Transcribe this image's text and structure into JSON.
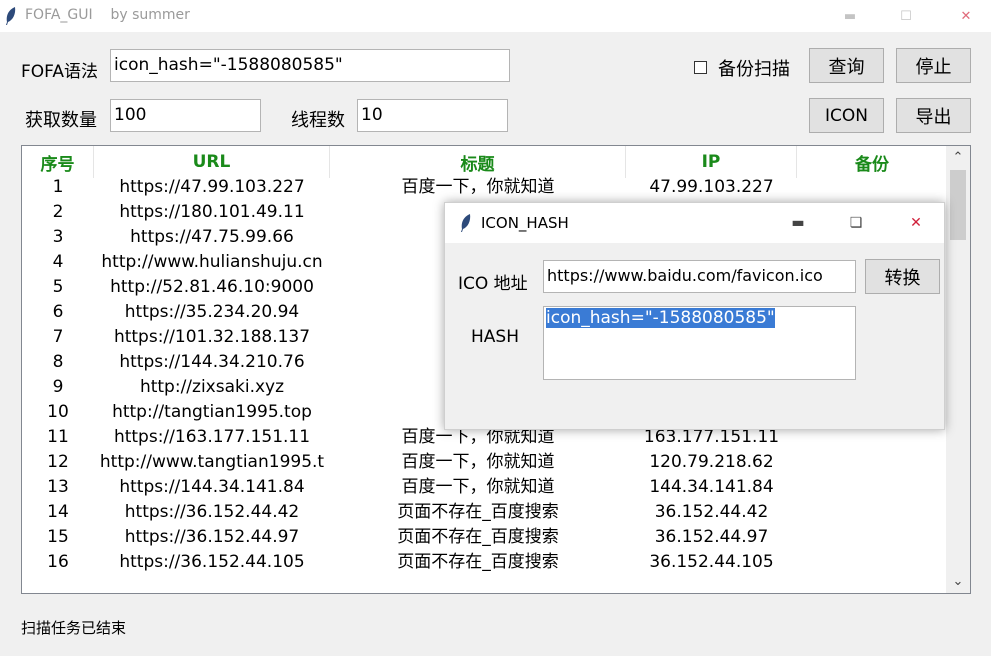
{
  "window": {
    "title": "FOFA_GUI    by summer",
    "minimize_icon": "minimize-icon",
    "maximize_icon": "maximize-icon",
    "close_icon": "close-icon"
  },
  "query": {
    "syntax_label": "FOFA语法",
    "syntax_value": "icon_hash=\"-1588080585\"",
    "backup_label": "备份扫描",
    "backup_checked": false,
    "search_button": "查询",
    "stop_button": "停止",
    "count_label": "获取数量",
    "count_value": "100",
    "threads_label": "线程数",
    "threads_value": "10",
    "icon_button": "ICON",
    "export_button": "导出"
  },
  "table": {
    "columns": [
      "序号",
      "URL",
      "标题",
      "IP",
      "备份"
    ],
    "rows": [
      [
        "1",
        "https://47.99.103.227",
        "百度一下，你就知道",
        "47.99.103.227",
        ""
      ],
      [
        "2",
        "https://180.101.49.11",
        "页面不",
        "",
        ""
      ],
      [
        "3",
        "https://47.75.99.66",
        "百度一",
        "",
        ""
      ],
      [
        "4",
        "http://www.hulianshuju.cn",
        "百度一",
        "",
        ""
      ],
      [
        "5",
        "http://52.81.46.10:9000",
        "百度一",
        "",
        ""
      ],
      [
        "6",
        "https://35.234.20.94",
        "百度一",
        "",
        ""
      ],
      [
        "7",
        "https://101.32.188.137",
        "百度一",
        "",
        ""
      ],
      [
        "8",
        "https://144.34.210.76",
        "百度一",
        "",
        ""
      ],
      [
        "9",
        "http://zixsaki.xyz",
        "百度一",
        "",
        ""
      ],
      [
        "10",
        "http://tangtian1995.top",
        "百度一",
        "",
        ""
      ],
      [
        "11",
        "https://163.177.151.11",
        "百度一下，你就知道",
        "163.177.151.11",
        ""
      ],
      [
        "12",
        "http://www.tangtian1995.t",
        "百度一下，你就知道",
        "120.79.218.62",
        ""
      ],
      [
        "13",
        "https://144.34.141.84",
        "百度一下，你就知道",
        "144.34.141.84",
        ""
      ],
      [
        "14",
        "https://36.152.44.42",
        "页面不存在_百度搜索",
        "36.152.44.42",
        ""
      ],
      [
        "15",
        "https://36.152.44.97",
        "页面不存在_百度搜索",
        "36.152.44.97",
        ""
      ],
      [
        "16",
        "https://36.152.44.105",
        "页面不存在_百度搜索",
        "36.152.44.105",
        ""
      ]
    ],
    "header_color": "#1a8a1a"
  },
  "status": {
    "text": "扫描任务已结束"
  },
  "dialog": {
    "title": "ICON_HASH",
    "ico_label": "ICO 地址",
    "ico_value": "https://www.baidu.com/favicon.ico",
    "convert_button": "转换",
    "hash_label": "HASH",
    "hash_value": "icon_hash=\"-1588080585\""
  }
}
